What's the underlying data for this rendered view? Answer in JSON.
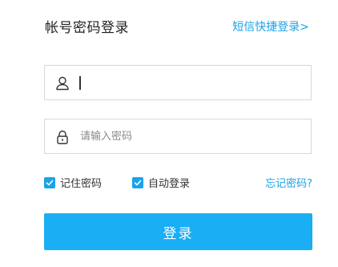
{
  "header": {
    "title": "帐号密码登录",
    "sms_login_link": "短信快捷登录>"
  },
  "form": {
    "username": {
      "value": "",
      "placeholder": "",
      "icon": "user-icon"
    },
    "password": {
      "value": "",
      "placeholder": "请输入密码",
      "icon": "lock-icon"
    }
  },
  "options": {
    "remember_password": {
      "label": "记住密码",
      "checked": true
    },
    "auto_login": {
      "label": "自动登录",
      "checked": true
    },
    "forgot_password": "忘记密码?"
  },
  "submit": {
    "label": "登录"
  },
  "colors": {
    "accent": "#1aa3e8",
    "button": "#1aaef4",
    "border": "#d8d8d8"
  }
}
